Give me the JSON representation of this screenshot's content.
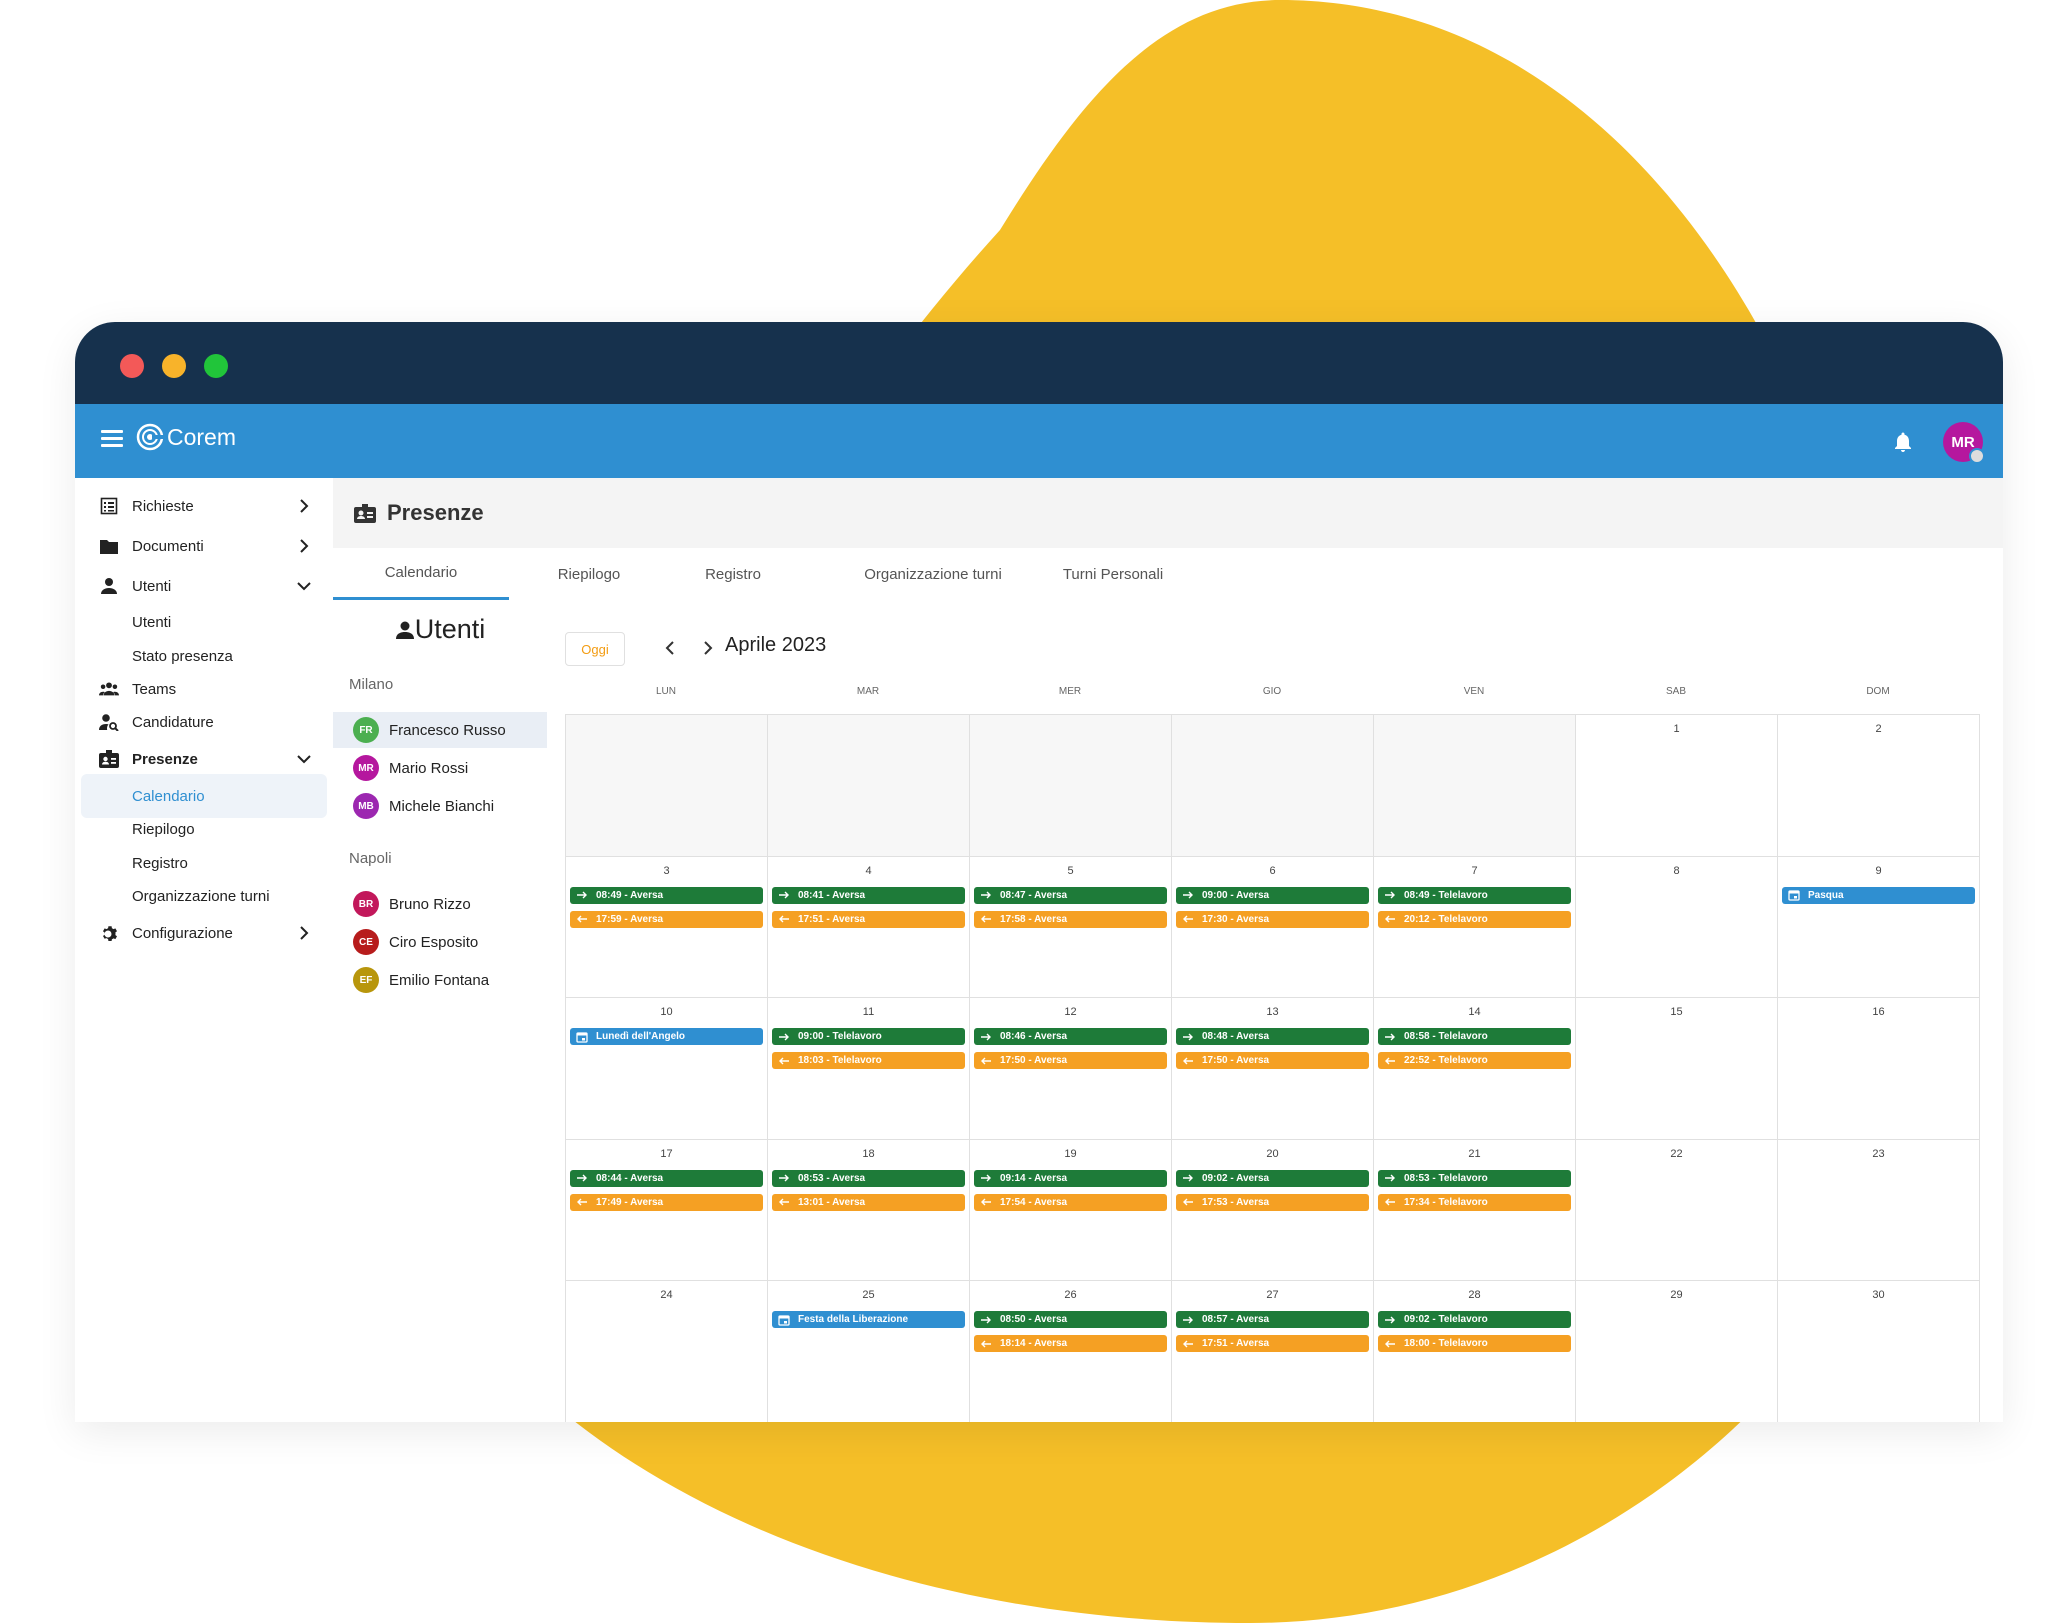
{
  "colors": {
    "blob": "#f5bf28",
    "titlebar": "#16314d",
    "appbar": "#2f8fd1",
    "entrance": "#1e7b39",
    "exit": "#f5a023",
    "holiday": "#2f8fd1",
    "close": "#f35958",
    "minimize": "#f8b32a",
    "maximize": "#21c53a"
  },
  "app": {
    "name": "Corem",
    "user_initials": "MR"
  },
  "sidebar": {
    "items": [
      {
        "label": "Richieste",
        "icon": "list-icon",
        "chevron": "right"
      },
      {
        "label": "Documenti",
        "icon": "folder-icon",
        "chevron": "right"
      },
      {
        "label": "Utenti",
        "icon": "person-icon",
        "chevron": "down"
      },
      {
        "label": "Utenti",
        "icon": "",
        "chevron": ""
      },
      {
        "label": "Stato presenza",
        "icon": "",
        "chevron": ""
      },
      {
        "label": "Teams",
        "icon": "group-icon",
        "chevron": ""
      },
      {
        "label": "Candidature",
        "icon": "person-search-icon",
        "chevron": ""
      },
      {
        "label": "Presenze",
        "icon": "badge-icon",
        "chevron": "down"
      },
      {
        "label": "Calendario",
        "icon": "",
        "chevron": ""
      },
      {
        "label": "Riepilogo",
        "icon": "",
        "chevron": ""
      },
      {
        "label": "Registro",
        "icon": "",
        "chevron": ""
      },
      {
        "label": "Organizzazione turni",
        "icon": "",
        "chevron": ""
      },
      {
        "label": "Configurazione",
        "icon": "gear-icon",
        "chevron": "right"
      }
    ]
  },
  "page": {
    "title": "Presenze"
  },
  "tabs": [
    "Calendario",
    "Riepilogo",
    "Registro",
    "Organizzazione turni",
    "Turni Personali"
  ],
  "users_panel": {
    "title": "Utenti",
    "groups": [
      {
        "name": "Milano",
        "users": [
          {
            "initials": "FR",
            "name": "Francesco Russo",
            "color": "#4caf50"
          },
          {
            "initials": "MR",
            "name": "Mario Rossi",
            "color": "#b5179e"
          },
          {
            "initials": "MB",
            "name": "Michele Bianchi",
            "color": "#9c27b0"
          }
        ]
      },
      {
        "name": "Napoli",
        "users": [
          {
            "initials": "BR",
            "name": "Bruno Rizzo",
            "color": "#c2185b"
          },
          {
            "initials": "CE",
            "name": "Ciro Esposito",
            "color": "#b71c1c"
          },
          {
            "initials": "EF",
            "name": "Emilio Fontana",
            "color": "#b8960c"
          }
        ]
      }
    ]
  },
  "calendar": {
    "today_label": "Oggi",
    "month_name": "Aprile",
    "year": "2023",
    "weekdays": [
      "LUN",
      "MAR",
      "MER",
      "GIO",
      "VEN",
      "SAB",
      "DOM"
    ],
    "weeks": [
      [
        {
          "day": ""
        },
        {
          "day": ""
        },
        {
          "day": ""
        },
        {
          "day": ""
        },
        {
          "day": ""
        },
        {
          "day": "1"
        },
        {
          "day": "2"
        }
      ],
      [
        {
          "day": "3",
          "in": "08:49 - Aversa",
          "out": "17:59 - Aversa"
        },
        {
          "day": "4",
          "in": "08:41 - Aversa",
          "out": "17:51 - Aversa"
        },
        {
          "day": "5",
          "in": "08:47 - Aversa",
          "out": "17:58 - Aversa"
        },
        {
          "day": "6",
          "in": "09:00 - Aversa",
          "out": "17:30 - Aversa"
        },
        {
          "day": "7",
          "in": "08:49 - Telelavoro",
          "out": "20:12 - Telelavoro"
        },
        {
          "day": "8"
        },
        {
          "day": "9",
          "holiday": "Pasqua"
        }
      ],
      [
        {
          "day": "10",
          "holiday": "Lunedì dell'Angelo"
        },
        {
          "day": "11",
          "in": "09:00 - Telelavoro",
          "out": "18:03 - Telelavoro"
        },
        {
          "day": "12",
          "in": "08:46 - Aversa",
          "out": "17:50 - Aversa"
        },
        {
          "day": "13",
          "in": "08:48 - Aversa",
          "out": "17:50 - Aversa"
        },
        {
          "day": "14",
          "in": "08:58 - Telelavoro",
          "out": "22:52 - Telelavoro"
        },
        {
          "day": "15"
        },
        {
          "day": "16"
        }
      ],
      [
        {
          "day": "17",
          "in": "08:44 - Aversa",
          "out": "17:49 - Aversa"
        },
        {
          "day": "18",
          "in": "08:53 - Aversa",
          "out": "13:01 - Aversa"
        },
        {
          "day": "19",
          "in": "09:14 - Aversa",
          "out": "17:54 - Aversa"
        },
        {
          "day": "20",
          "in": "09:02 - Aversa",
          "out": "17:53 - Aversa"
        },
        {
          "day": "21",
          "in": "08:53 - Telelavoro",
          "out": "17:34 - Telelavoro"
        },
        {
          "day": "22"
        },
        {
          "day": "23"
        }
      ],
      [
        {
          "day": "24"
        },
        {
          "day": "25",
          "holiday": "Festa della Liberazione"
        },
        {
          "day": "26",
          "in": "08:50 - Aversa",
          "out": "18:14 - Aversa"
        },
        {
          "day": "27",
          "in": "08:57 - Aversa",
          "out": "17:51 - Aversa"
        },
        {
          "day": "28",
          "in": "09:02 - Telelavoro",
          "out": "18:00 - Telelavoro"
        },
        {
          "day": "29"
        },
        {
          "day": "30"
        }
      ]
    ]
  }
}
